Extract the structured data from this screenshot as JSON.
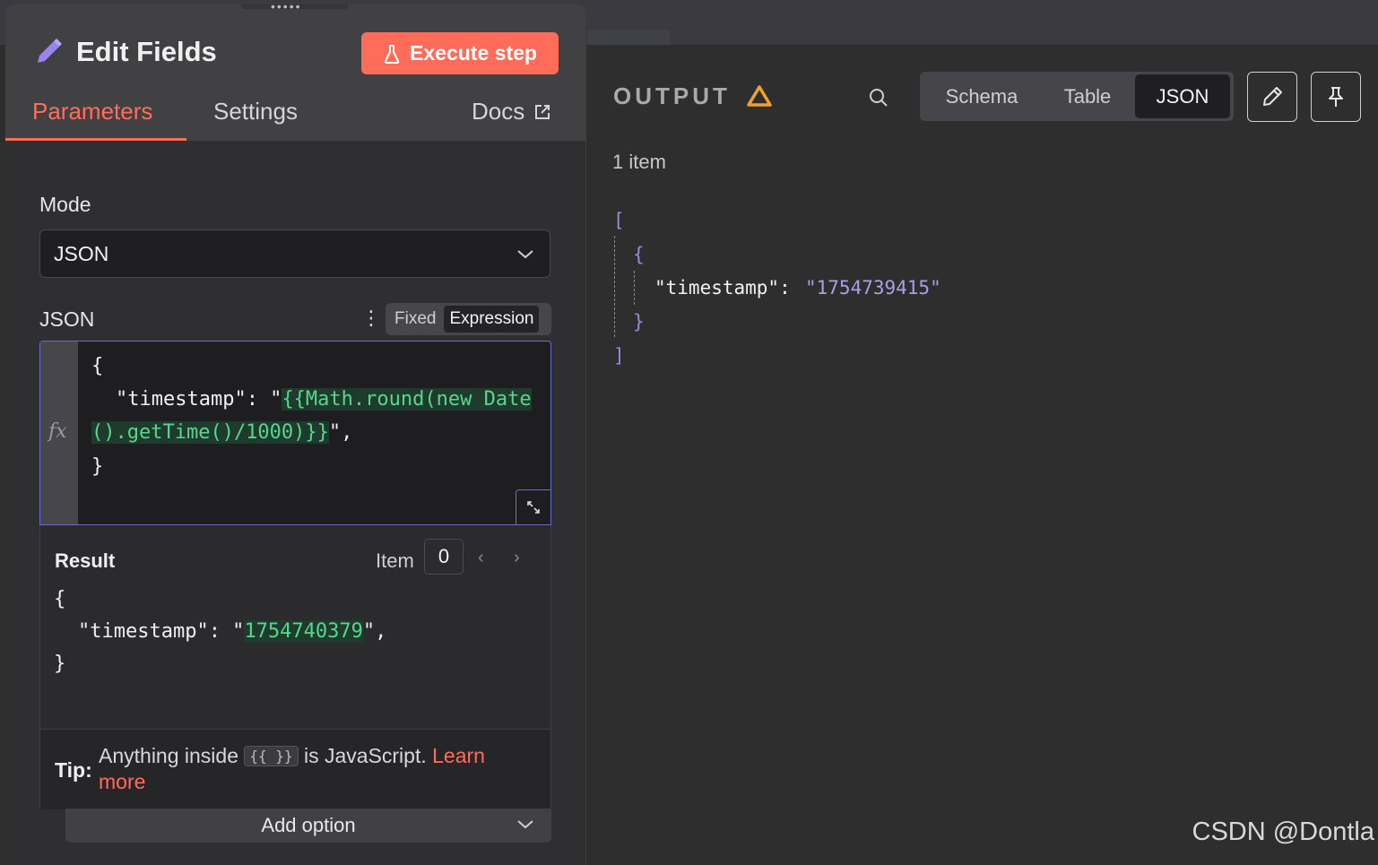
{
  "editor": {
    "title": "Edit Fields",
    "execute_label": "Execute step",
    "tabs": {
      "parameters": "Parameters",
      "settings": "Settings",
      "docs": "Docs"
    },
    "mode": {
      "label": "Mode",
      "value": "JSON"
    },
    "json_field": {
      "label": "JSON",
      "toggle": {
        "fixed": "Fixed",
        "expression": "Expression"
      },
      "fx": "fx",
      "code": {
        "open_brace": "{",
        "key_prefix": "\"timestamp\": \"",
        "expr_line1": "{{Math.round(new Date",
        "expr_line2": "().getTime()/1000)}}",
        "suffix": "\",",
        "close_brace": "}"
      }
    },
    "result": {
      "label": "Result",
      "item_label": "Item",
      "item_index": "0",
      "open_brace": "{",
      "key_prefix": "\"timestamp\": \"",
      "value": "1754740379",
      "suffix": "\",",
      "close_brace": "}"
    },
    "tip": {
      "label": "Tip:",
      "text_before": "Anything inside",
      "code": "{{ }}",
      "text_after": "is JavaScript.",
      "link": "Learn more"
    },
    "add_option": "Add option"
  },
  "output": {
    "title": "OUTPUT",
    "views": {
      "schema": "Schema",
      "table": "Table",
      "json": "JSON"
    },
    "active_view": "JSON",
    "item_count": "1 item",
    "json": {
      "open_array": "[",
      "open_obj": "{",
      "key": "\"timestamp\":",
      "value": "\"1754739415\"",
      "close_obj": "}",
      "close_array": "]"
    }
  },
  "watermark": "CSDN @Dontla",
  "colors": {
    "accent": "#ff6d5a",
    "expression_border": "#6b6bcf",
    "warning": "#f0a030",
    "highlight_text": "#58d68d"
  }
}
